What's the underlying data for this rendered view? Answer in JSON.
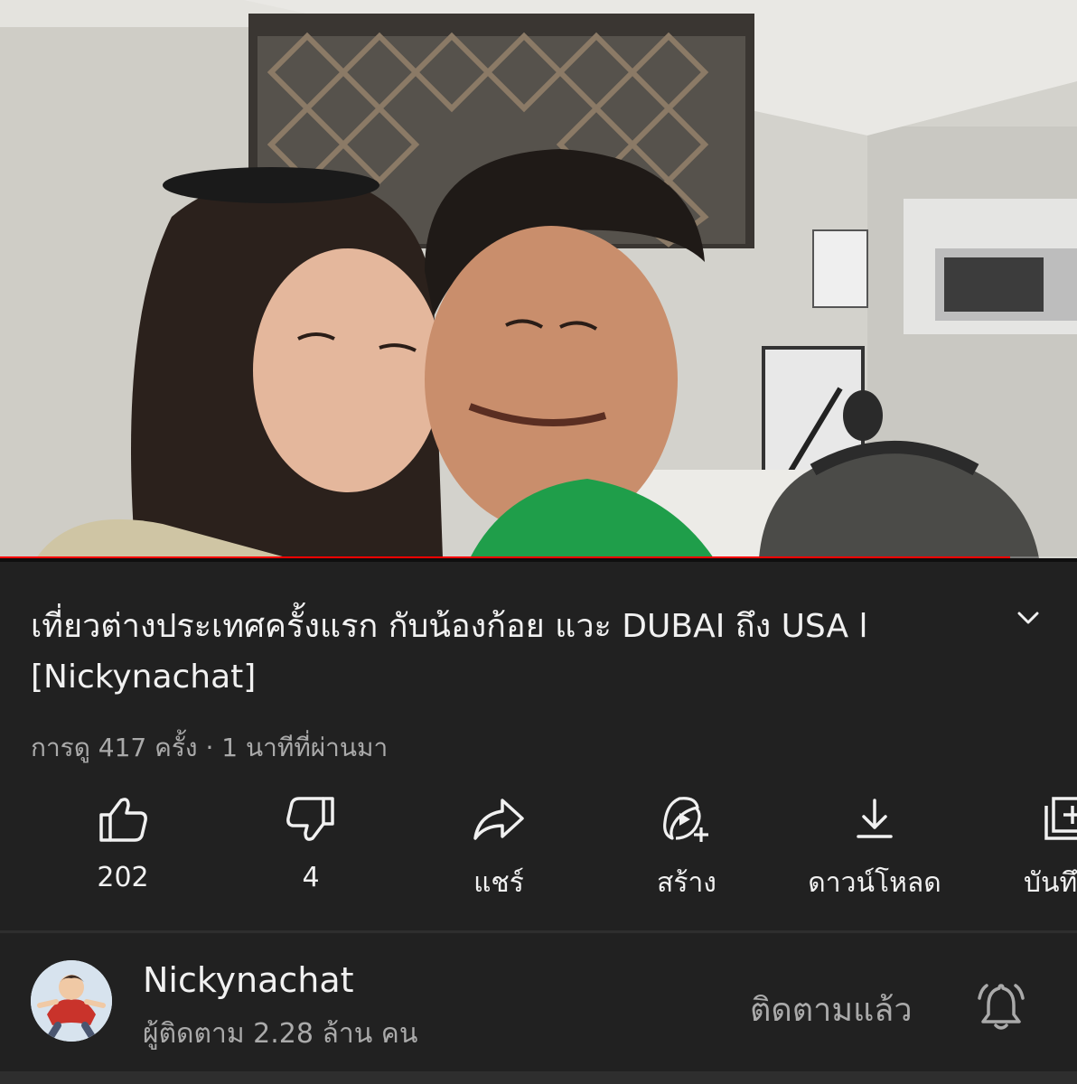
{
  "video": {
    "title": "เที่ยวต่างประเทศครั้งแรก กับน้องก้อย แวะ DUBAI ถึง USA l [Nickynachat]",
    "meta": "การดู 417 ครั้ง · 1 นาทีที่ผ่านมา",
    "progress_fraction": 0.938
  },
  "actions": [
    {
      "icon": "thumbs-up-icon",
      "label": "202"
    },
    {
      "icon": "thumbs-down-icon",
      "label": "4"
    },
    {
      "icon": "share-icon",
      "label": "แชร์"
    },
    {
      "icon": "create-icon",
      "label": "สร้าง"
    },
    {
      "icon": "download-icon",
      "label": "ดาวน์โหลด"
    },
    {
      "icon": "save-icon",
      "label": "บันทึก"
    }
  ],
  "channel": {
    "name": "Nickynachat",
    "subscribers": "ผู้ติดตาม 2.28 ล้าน คน",
    "subscribe_state": "ติดตามแล้ว",
    "bell_icon": "bell-icon"
  },
  "colors": {
    "background": "#212121",
    "progress": "#ff0000",
    "text_primary": "#f1f1f1",
    "text_secondary": "#aaaaaa"
  }
}
